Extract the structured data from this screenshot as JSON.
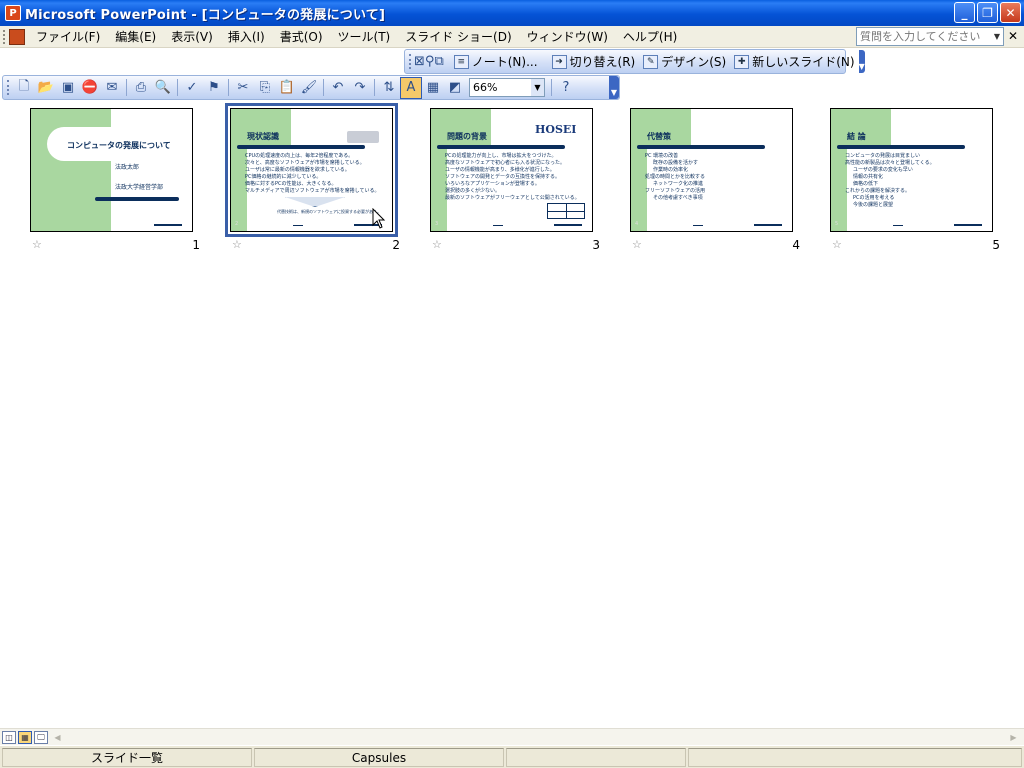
{
  "window": {
    "icon": "P",
    "title": "Microsoft PowerPoint - [コンピュータの発展について]"
  },
  "menu": {
    "items": [
      "ファイル(F)",
      "編集(E)",
      "表示(V)",
      "挿入(I)",
      "書式(O)",
      "ツール(T)",
      "スライド ショー(D)",
      "ウィンドウ(W)",
      "ヘルプ(H)"
    ],
    "help_placeholder": "質問を入力してください"
  },
  "toolbar_top": {
    "notes_label": "ノート(N)...",
    "transition_label": "切り替え(R)",
    "design_label": "デザイン(S)",
    "new_slide_label": "新しいスライド(N)"
  },
  "toolbar_standard": {
    "zoom_value": "66%"
  },
  "slides": [
    {
      "number": "1",
      "title": "コンピュータの発展について",
      "lines": [
        "法政太郎",
        "法政大学経営学部"
      ]
    },
    {
      "number": "2",
      "title": "現状認識",
      "lines": [
        "CPUの処理速度の向上は、毎年2倍程度である。",
        "次々と、高度なソフトウェアが市場を席捲している。",
        "ユーザは常に最新の情報機器を欲求している。",
        "PC価格の継続的に減少している。",
        "価格に対するPCの性能は、大きくなる。",
        "マルチメディアで周辺ソフトウェアが市場を席捲している。"
      ],
      "callout": "代替技術は、新規のソフトウェアに投資する必要がある。"
    },
    {
      "number": "3",
      "title": "問題の背景",
      "logo": "HOSEI",
      "lines": [
        "PCの処理能力が向上し、市場は拡大をつづけた。",
        "高度なソフトウェアで初心者にも入る状況になった。",
        "ユーザの情報機能が高まり、多様化が進行した。",
        "ソフトウェアの開発とデータの互換性を保持する。",
        "いろいろなアプリケーションが登場する。",
        "選択肢の多くが少ない。",
        "最新のソフトウェアがフリーウェアとして公開されている。"
      ]
    },
    {
      "number": "4",
      "title": "代替策",
      "lines": [
        "PC 環境の改善",
        "既存の設備を活かす",
        "作業時の効率化",
        "処理の時間とかを比較する",
        "ネットワーク化の推進",
        "フリーソフトウェアの活用",
        "その他考慮すべき事項"
      ]
    },
    {
      "number": "5",
      "title": "結 論",
      "lines": [
        "コンピュータの発展は目覚ましい",
        "高性能の新製品は次々と登場してくる。",
        "ユーザの要求の変化も早い",
        "情報の共有化",
        "価格の低下",
        "これからの課題を解決する。",
        "PCの活用を考える",
        "今後の課題と展望"
      ]
    }
  ],
  "statusbar": {
    "view": "スライド一覧",
    "template": "Capsules"
  },
  "icons": [
    "app-icon",
    "new-icon",
    "open-icon",
    "save-icon",
    "print-icon",
    "spell-icon",
    "cut-icon",
    "copy-icon",
    "paste-icon",
    "undo-icon",
    "redo-icon",
    "help-icon",
    "star-icon"
  ]
}
